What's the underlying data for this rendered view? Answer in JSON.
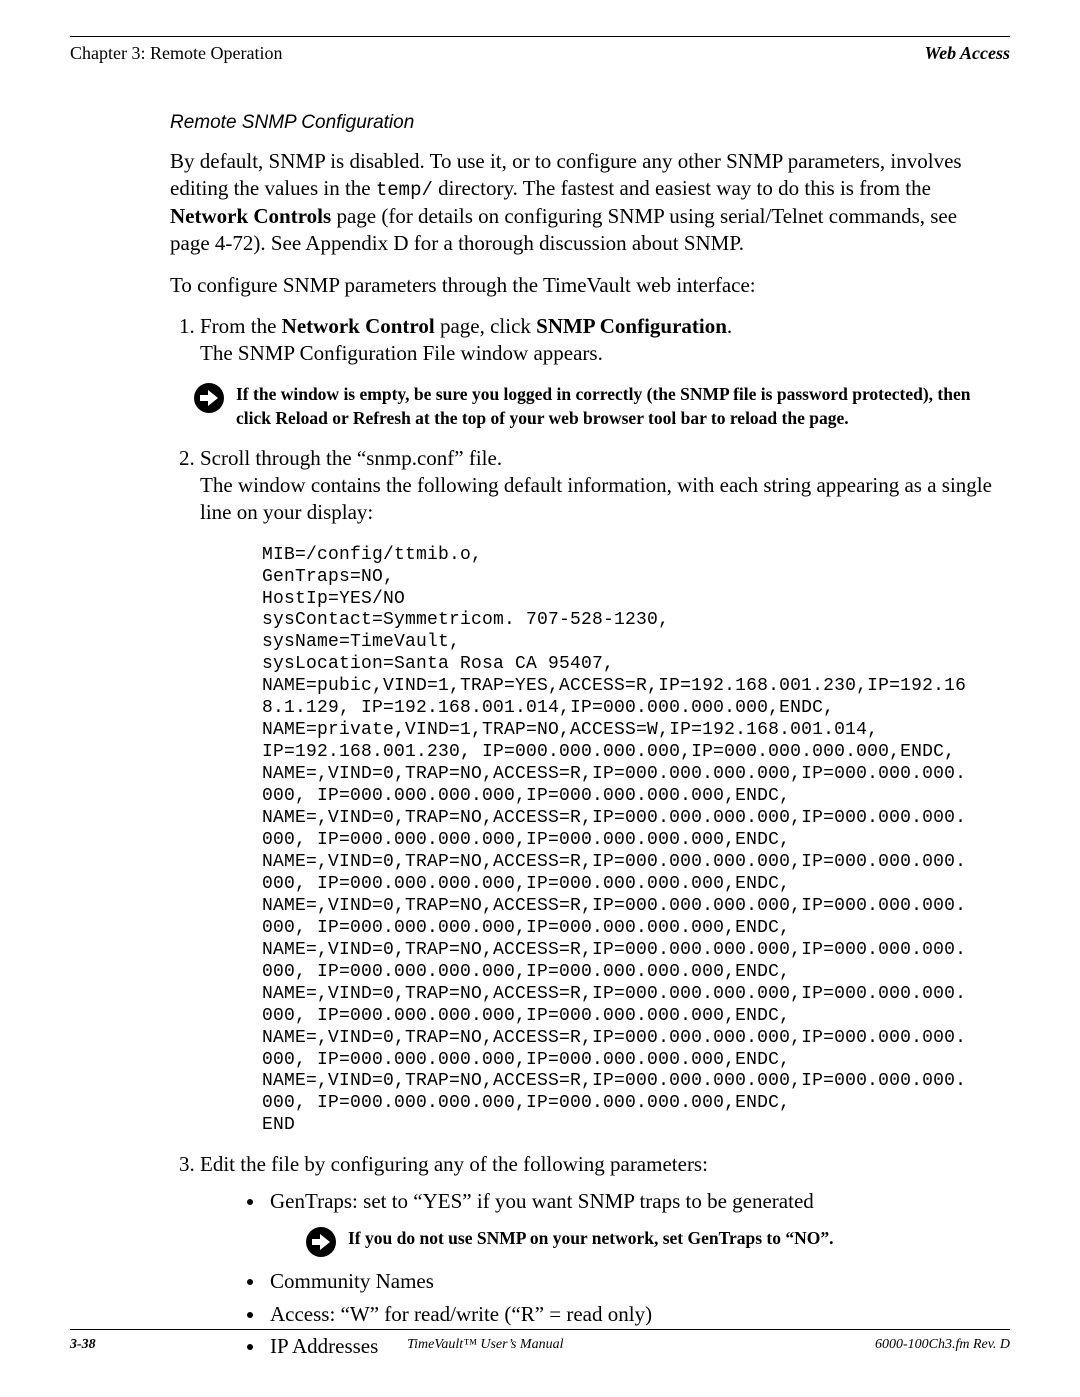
{
  "header": {
    "left": "Chapter 3: Remote Operation",
    "right": "Web Access"
  },
  "section_heading": "Remote SNMP Configuration",
  "para1_before_code": "By default, SNMP is disabled.  To use it, or to configure any other SNMP parameters, involves editing the values in the ",
  "para1_code": "temp/",
  "para1_after_code": "  directory.  The fastest and easiest way to do this is from the ",
  "para1_bold": "Network Controls",
  "para1_tail": " page (for details on configuring SNMP using serial/Telnet commands, see page 4-72).  See Appendix D for a thorough discussion about SNMP.",
  "para2": "To configure SNMP parameters through the TimeVault web interface:",
  "steps": {
    "s1_a": "From the ",
    "s1_b1": "Network Control",
    "s1_c": " page, click ",
    "s1_b2": "SNMP Configuration",
    "s1_d": ".",
    "s1_line2": "The SNMP Configuration File window appears.",
    "note1": "If the window is empty, be sure you logged in correctly (the SNMP file is password protected), then click Reload or Refresh at the top of your web browser tool bar to reload the page.",
    "s2_line1": "Scroll through the “snmp.conf” file.",
    "s2_line2": "The window contains the following default information, with each string appearing as a single line on your display:",
    "config": "MIB=/config/ttmib.o,\nGenTraps=NO,\nHostIp=YES/NO\nsysContact=Symmetricom. 707-528-1230,\nsysName=TimeVault,\nsysLocation=Santa Rosa CA 95407,\nNAME=pubic,VIND=1,TRAP=YES,ACCESS=R,IP=192.168.001.230,IP=192.16\n8.1.129, IP=192.168.001.014,IP=000.000.000.000,ENDC,\nNAME=private,VIND=1,TRAP=NO,ACCESS=W,IP=192.168.001.014,\nIP=192.168.001.230, IP=000.000.000.000,IP=000.000.000.000,ENDC,\nNAME=,VIND=0,TRAP=NO,ACCESS=R,IP=000.000.000.000,IP=000.000.000.\n000, IP=000.000.000.000,IP=000.000.000.000,ENDC,\nNAME=,VIND=0,TRAP=NO,ACCESS=R,IP=000.000.000.000,IP=000.000.000.\n000, IP=000.000.000.000,IP=000.000.000.000,ENDC,\nNAME=,VIND=0,TRAP=NO,ACCESS=R,IP=000.000.000.000,IP=000.000.000.\n000, IP=000.000.000.000,IP=000.000.000.000,ENDC,\nNAME=,VIND=0,TRAP=NO,ACCESS=R,IP=000.000.000.000,IP=000.000.000.\n000, IP=000.000.000.000,IP=000.000.000.000,ENDC,\nNAME=,VIND=0,TRAP=NO,ACCESS=R,IP=000.000.000.000,IP=000.000.000.\n000, IP=000.000.000.000,IP=000.000.000.000,ENDC,\nNAME=,VIND=0,TRAP=NO,ACCESS=R,IP=000.000.000.000,IP=000.000.000.\n000, IP=000.000.000.000,IP=000.000.000.000,ENDC,\nNAME=,VIND=0,TRAP=NO,ACCESS=R,IP=000.000.000.000,IP=000.000.000.\n000, IP=000.000.000.000,IP=000.000.000.000,ENDC,\nNAME=,VIND=0,TRAP=NO,ACCESS=R,IP=000.000.000.000,IP=000.000.000.\n000, IP=000.000.000.000,IP=000.000.000.000,ENDC,\nEND",
    "s3_line1": "Edit the file by configuring any of the following parameters:",
    "bullets": {
      "b1": "GenTraps: set to “YES” if you want SNMP traps to be generated",
      "b2": "Community Names",
      "b3": "Access: “W” for read/write (“R” = read only)",
      "b4": "IP Addresses"
    },
    "note2": "If you do not use SNMP on your network, set GenTraps to “NO”."
  },
  "footer": {
    "left": "3-38",
    "center": "TimeVault™ User’s Manual",
    "right": "6000-100Ch3.fm  Rev. D"
  }
}
